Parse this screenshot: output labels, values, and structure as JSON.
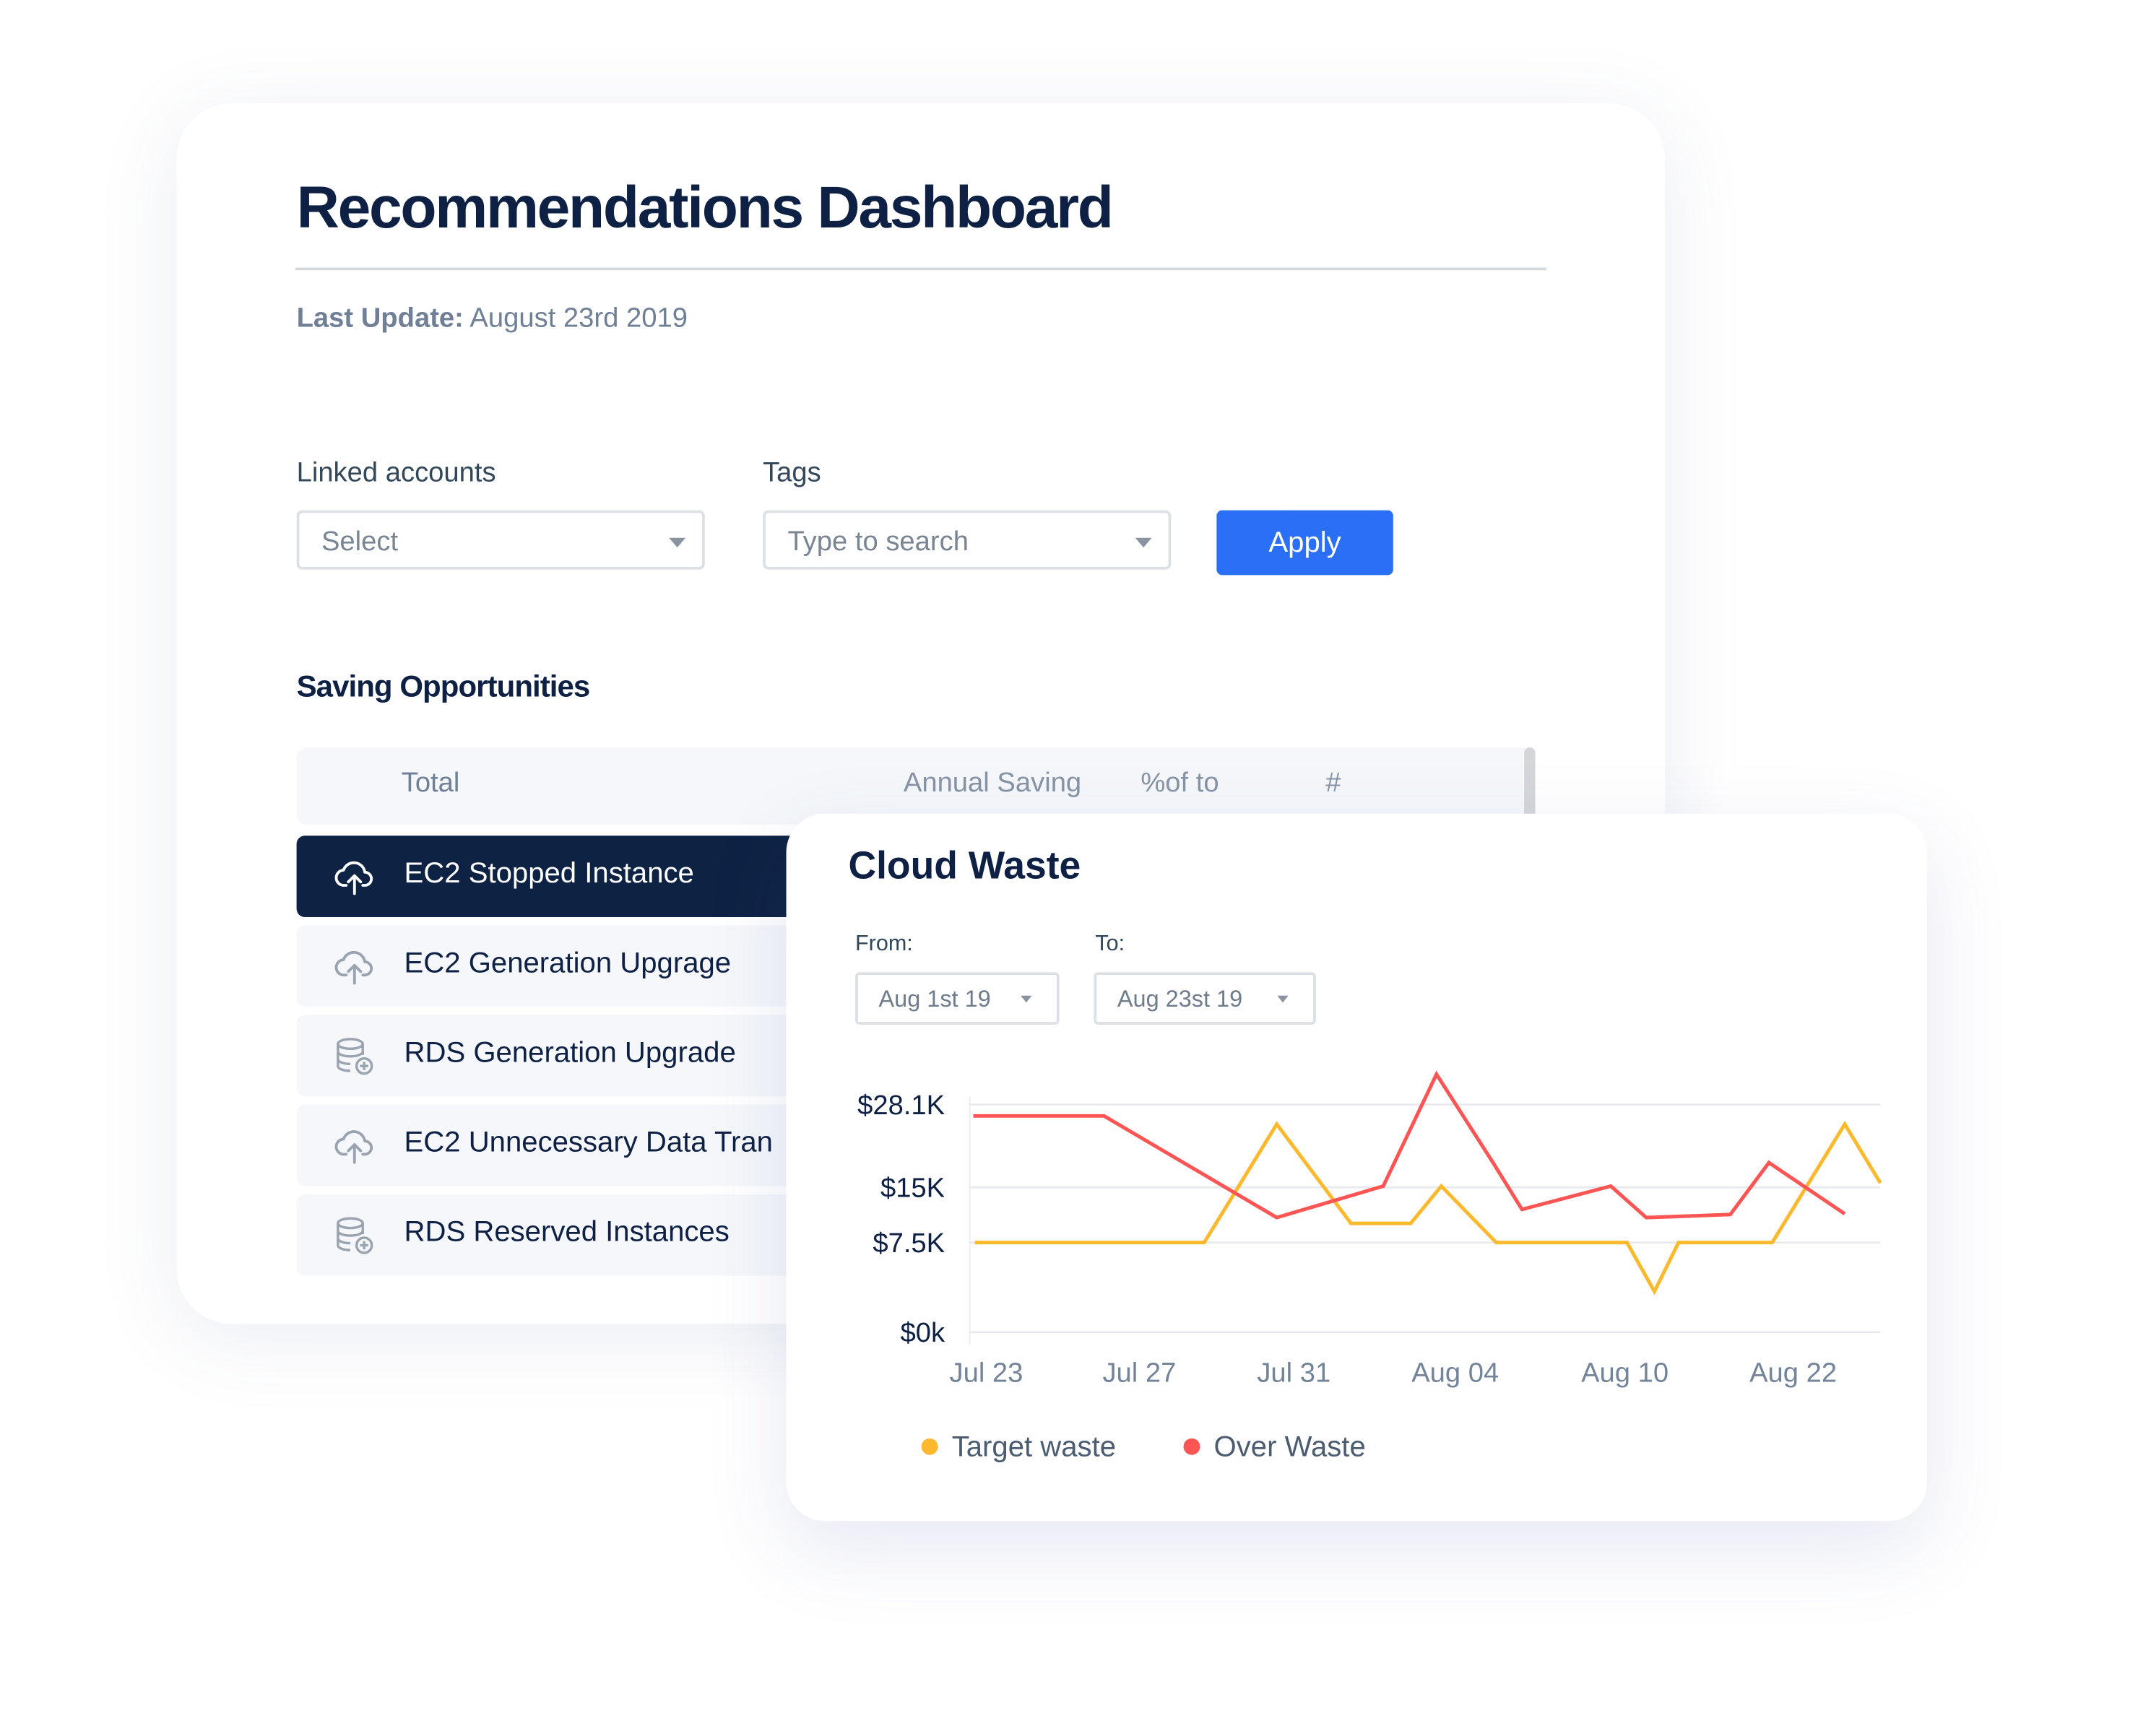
{
  "dashboard": {
    "title": "Recommendations Dashboard",
    "last_update_label": "Last Update:",
    "last_update_value": "August 23rd 2019",
    "filters": {
      "linked_accounts_label": "Linked accounts",
      "linked_accounts_placeholder": "Select",
      "tags_label": "Tags",
      "tags_placeholder": "Type to search",
      "apply_label": "Apply"
    },
    "section_title": "Saving Opportunities",
    "table": {
      "columns": [
        "Total",
        "Annual Saving",
        "%of to",
        "#"
      ],
      "rows": [
        {
          "label": "EC2 Stopped Instance",
          "icon": "cloud-upload-icon",
          "active": true
        },
        {
          "label": "EC2 Generation Upgrage",
          "icon": "cloud-upload-icon",
          "active": false
        },
        {
          "label": "RDS Generation Upgrade",
          "icon": "database-add-icon",
          "active": false
        },
        {
          "label": "EC2 Unnecessary Data Tran",
          "icon": "cloud-upload-icon",
          "active": false
        },
        {
          "label": "RDS Reserved Instances",
          "icon": "database-add-icon",
          "active": false
        }
      ]
    }
  },
  "cloud_waste": {
    "title": "Cloud Waste",
    "from_label": "From:",
    "from_value": "Aug 1st 19",
    "to_label": "To:",
    "to_value": "Aug 23st 19"
  },
  "chart_data": {
    "type": "line",
    "x_tick_labels": [
      "Jul 23",
      "Jul 27",
      "Jul 31",
      "Aug 04",
      "Aug 10",
      "Aug 22"
    ],
    "y_tick_labels": [
      "$28.1K",
      "$15K",
      "$7.5K",
      "$0k"
    ],
    "y_tick_values": [
      28.1,
      15,
      7.5,
      0
    ],
    "y_unit": "$K",
    "grid": "horizontal",
    "legend_position": "bottom-left",
    "x_note": "x given in tick-index units (0 = Jul 23 ... 5 = Aug 22)",
    "series": [
      {
        "name": "Target waste",
        "color": "#fdb92e",
        "points": [
          [
            -0.07,
            7.5
          ],
          [
            1.35,
            7.5
          ],
          [
            1.8,
            25.0
          ],
          [
            2.26,
            10.1
          ],
          [
            2.63,
            10.1
          ],
          [
            2.82,
            15.2
          ],
          [
            3.16,
            7.5
          ],
          [
            3.97,
            7.5
          ],
          [
            4.14,
            3.4
          ],
          [
            4.29,
            7.5
          ],
          [
            4.87,
            7.5
          ],
          [
            5.32,
            25.0
          ],
          [
            5.54,
            15.7
          ]
        ]
      },
      {
        "name": "Over Waste",
        "color": "#fd5454",
        "points": [
          [
            -0.08,
            26.3
          ],
          [
            0.73,
            26.3
          ],
          [
            1.8,
            10.9
          ],
          [
            2.46,
            15.2
          ],
          [
            2.79,
            32.9
          ],
          [
            3.14,
            18.9
          ],
          [
            3.32,
            12.0
          ],
          [
            3.87,
            15.2
          ],
          [
            4.09,
            10.9
          ],
          [
            4.61,
            11.3
          ],
          [
            4.85,
            18.9
          ],
          [
            5.32,
            11.4
          ]
        ]
      }
    ]
  }
}
